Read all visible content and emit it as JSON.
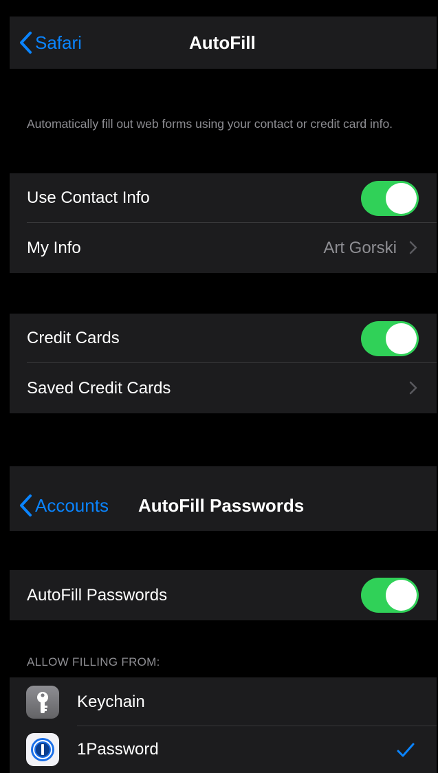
{
  "autofill_screen": {
    "back_label": "Safari",
    "title": "AutoFill",
    "footnote": "Automatically fill out web forms using your contact or credit card info.",
    "contact_group": {
      "use_contact_info": {
        "label": "Use Contact Info",
        "enabled": true
      },
      "my_info": {
        "label": "My Info",
        "value": "Art Gorski"
      }
    },
    "cards_group": {
      "credit_cards": {
        "label": "Credit Cards",
        "enabled": true
      },
      "saved_credit_cards": {
        "label": "Saved Credit Cards"
      }
    }
  },
  "passwords_screen": {
    "back_label": "Accounts",
    "title": "AutoFill Passwords",
    "autofill_passwords": {
      "label": "AutoFill Passwords",
      "enabled": true
    },
    "section_header": "ALLOW FILLING FROM:",
    "providers": [
      {
        "label": "Keychain",
        "icon": "key-icon",
        "selected": false
      },
      {
        "label": "1Password",
        "icon": "1password-icon",
        "selected": true
      }
    ]
  },
  "colors": {
    "accent": "#0a84ff",
    "toggle_on": "#30d158",
    "cell_background": "#1c1c1e",
    "secondary_text": "#8e8e93"
  }
}
